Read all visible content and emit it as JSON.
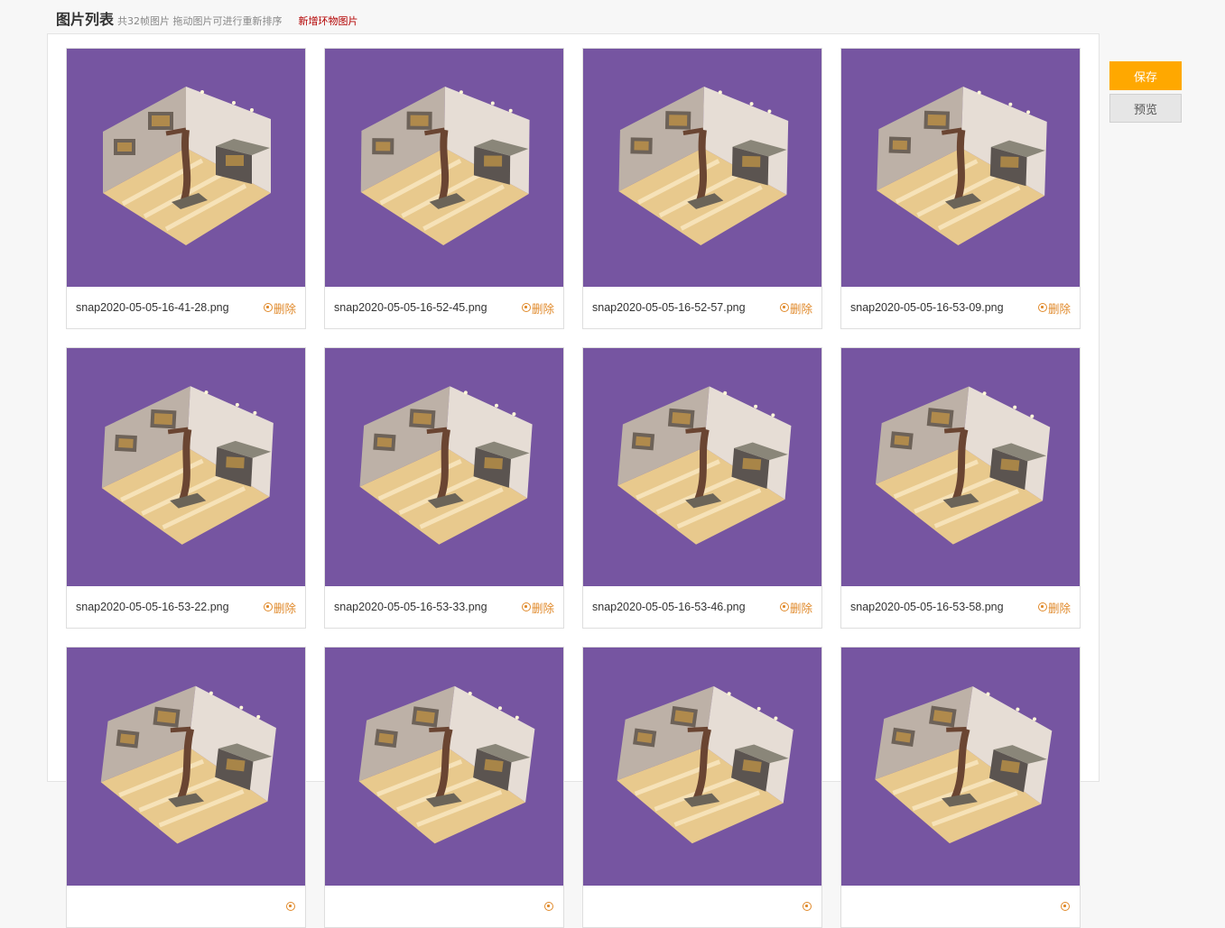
{
  "header": {
    "title": "图片列表",
    "subtitle": "共32帧图片  拖动图片可进行重新排序",
    "add_link": "新增环物图片"
  },
  "actions": {
    "save": "保存",
    "preview": "预览"
  },
  "images": [
    {
      "name": "snap2020-05-05-16-41-28.png",
      "delete": "删除"
    },
    {
      "name": "snap2020-05-05-16-52-45.png",
      "delete": "删除"
    },
    {
      "name": "snap2020-05-05-16-52-57.png",
      "delete": "删除"
    },
    {
      "name": "snap2020-05-05-16-53-09.png",
      "delete": "删除"
    },
    {
      "name": "snap2020-05-05-16-53-22.png",
      "delete": "删除"
    },
    {
      "name": "snap2020-05-05-16-53-33.png",
      "delete": "删除"
    },
    {
      "name": "snap2020-05-05-16-53-46.png",
      "delete": "删除"
    },
    {
      "name": "snap2020-05-05-16-53-58.png",
      "delete": "删除"
    },
    {
      "name": "",
      "delete": ""
    },
    {
      "name": "",
      "delete": ""
    },
    {
      "name": "",
      "delete": ""
    },
    {
      "name": "",
      "delete": ""
    }
  ],
  "colors": {
    "thumb_bg": "#7655a1",
    "accent": "#ffa800",
    "delete": "#e0892a",
    "link": "#b30000"
  }
}
